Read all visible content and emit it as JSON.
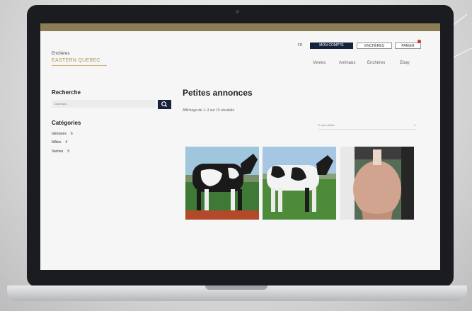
{
  "header": {
    "logo_top": "Enchères",
    "logo_main": "EASTERN QUEBEC",
    "lang": "FR",
    "account_button": "MON COMPTE",
    "auction_button": "ENCHÈRES",
    "cart_button": "PANIER",
    "nav": [
      "Ventes",
      "Animaux",
      "Enchères",
      "Ebay"
    ]
  },
  "sidebar": {
    "search_title": "Recherche",
    "search_placeholder": "Chercher...",
    "categories_title": "Catégories",
    "categories": [
      {
        "label": "Génisses",
        "count": "6"
      },
      {
        "label": "Mâles",
        "count": "4"
      },
      {
        "label": "Vaches",
        "count": "5"
      }
    ]
  },
  "main": {
    "title": "Petites annonces",
    "results": "Affichage de 1–3 sur 15 résultats",
    "sort_label": "Tri par défaut",
    "listings": [
      {
        "image": "holstein-cow-side-profile"
      },
      {
        "image": "holstein-cow-field"
      },
      {
        "image": "cow-udder-rear-view"
      }
    ]
  },
  "colors": {
    "navy": "#15233b",
    "gold": "#b39656",
    "gold_bar": "#8b7d55"
  }
}
